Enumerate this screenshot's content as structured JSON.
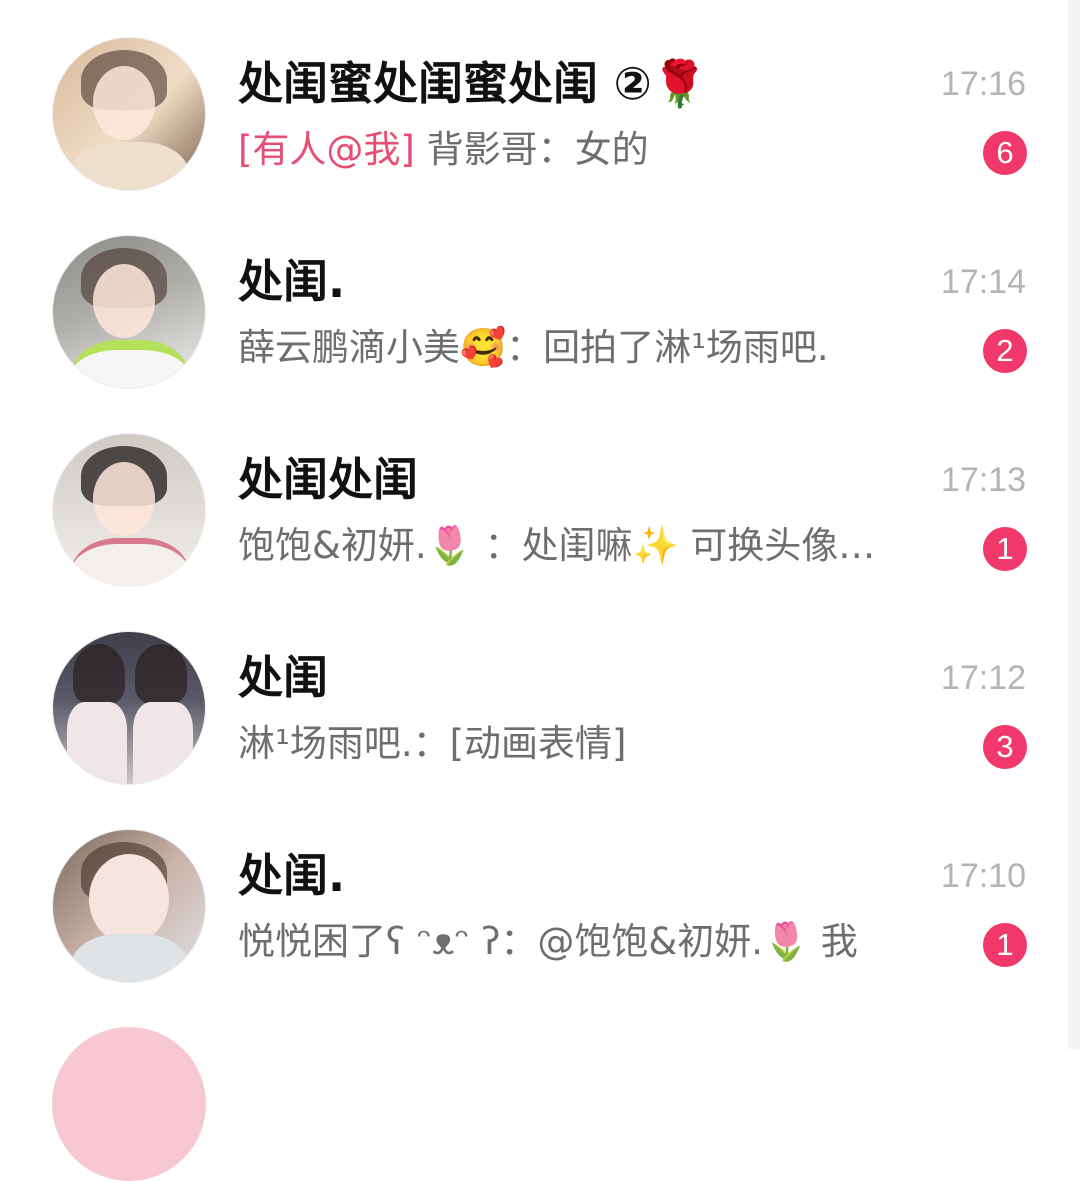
{
  "chats": [
    {
      "title": "处闺蜜处闺蜜处闺 ②🌹",
      "time": "17:16",
      "mention": "[有人@我]",
      "preview": " 背影哥：女的",
      "unread": "6",
      "avatar_colors": [
        "#d9b899",
        "#7a5f4a",
        "#f1ddc7"
      ]
    },
    {
      "title": "处闺.",
      "time": "17:14",
      "mention": "",
      "preview": "薛云鹏滴小美🥰：回拍了淋¹场雨吧.",
      "unread": "2",
      "avatar_colors": [
        "#8b8b88",
        "#f2f2f2",
        "#b5e05a"
      ]
    },
    {
      "title": "处闺处闺",
      "time": "17:13",
      "mention": "",
      "preview": "饱饱&初妍.🌷 ：处闺嘛✨ 可换头像…",
      "unread": "1",
      "avatar_colors": [
        "#cfcac4",
        "#f3efea",
        "#d67a8d"
      ]
    },
    {
      "title": "处闺",
      "time": "17:12",
      "mention": "",
      "preview": "淋¹场雨吧.：[动画表情]",
      "unread": "3",
      "avatar_colors": [
        "#5a5a68",
        "#efe6e8",
        "#e48a96"
      ]
    },
    {
      "title": "处闺.",
      "time": "17:10",
      "mention": "",
      "preview": "悦悦困了ʕ ᵔᴥᵔ ʔ：@饱饱&初妍.🌷 我",
      "unread": "1",
      "avatar_colors": [
        "#7a6a5c",
        "#f6e4df",
        "#dfe3e6"
      ]
    }
  ]
}
